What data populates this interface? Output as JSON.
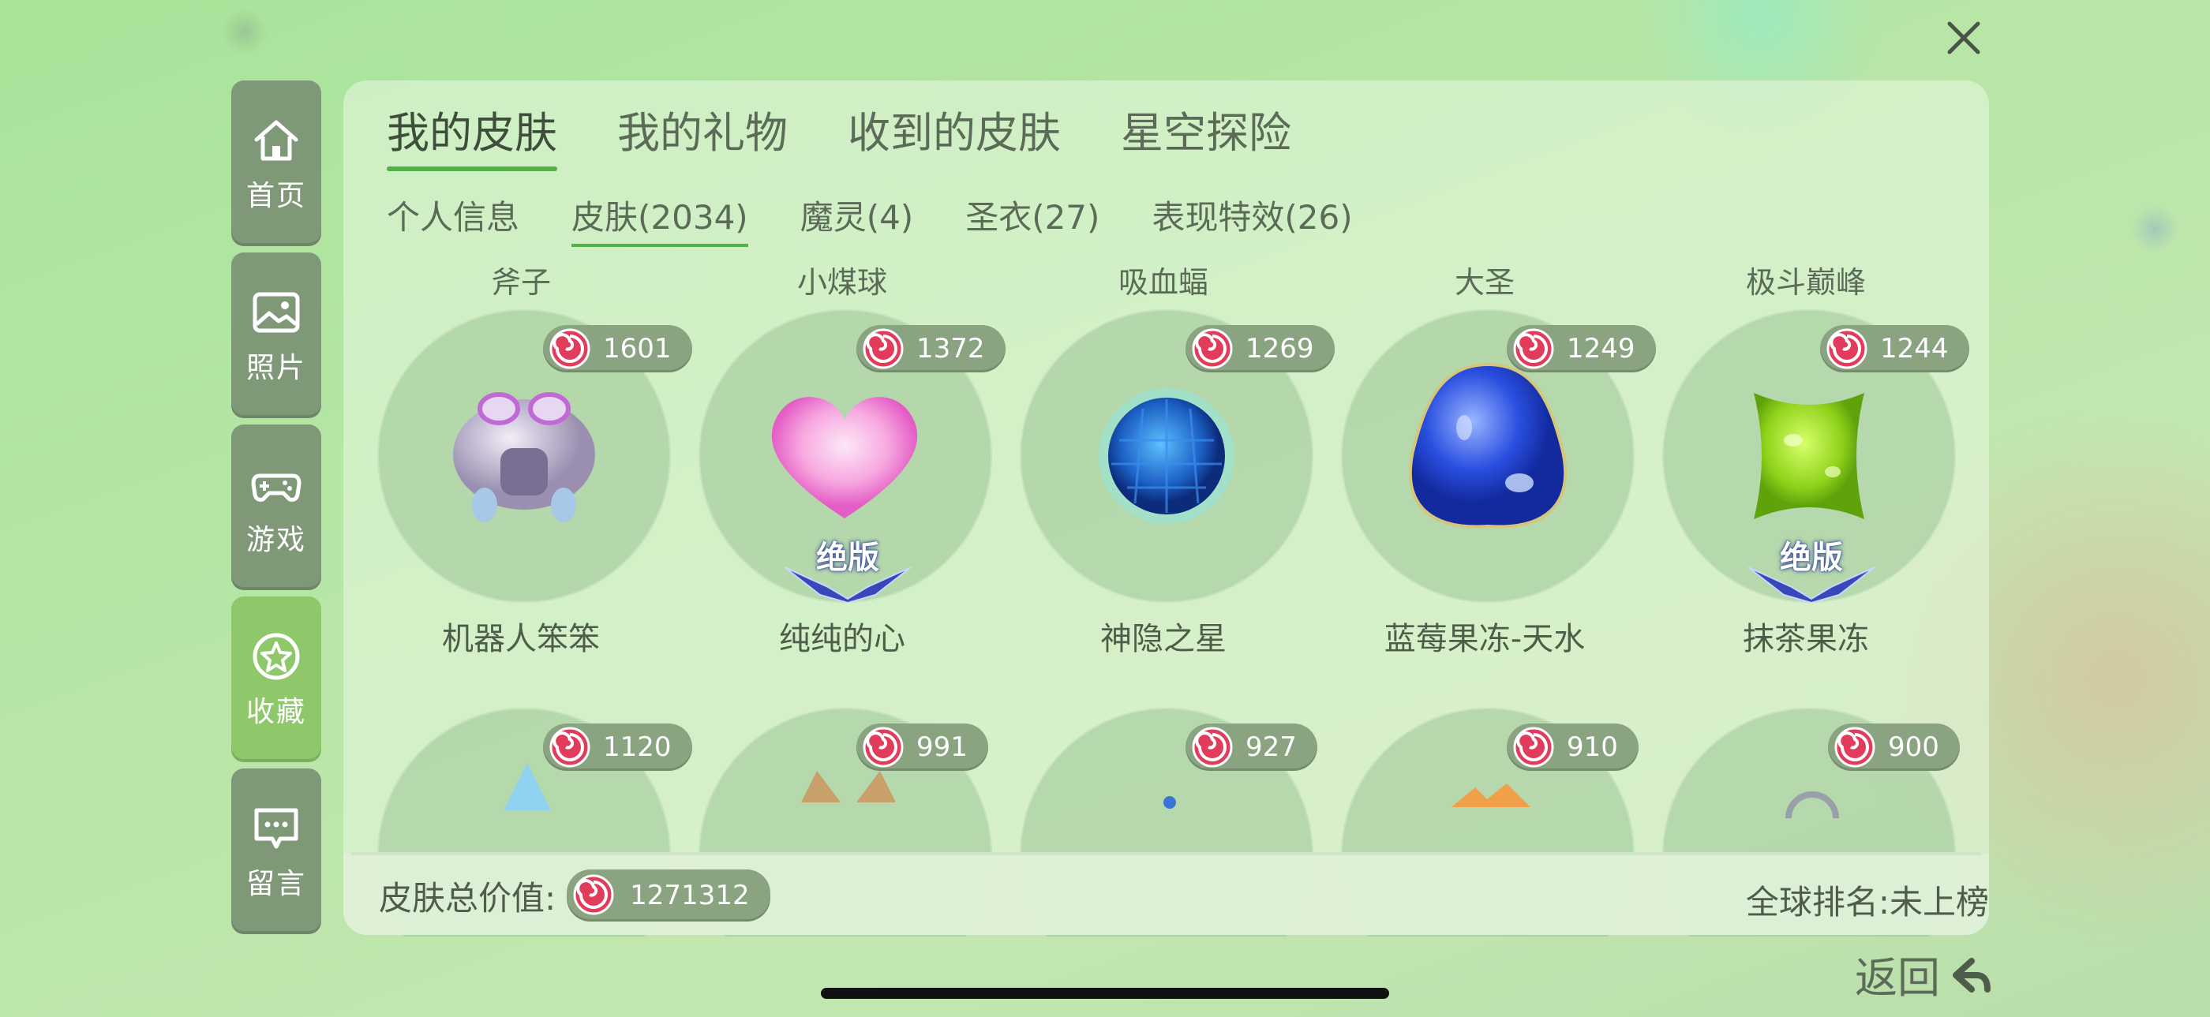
{
  "top_tabs": [
    {
      "label": "我的皮肤",
      "active": true
    },
    {
      "label": "我的礼物",
      "active": false
    },
    {
      "label": "收到的皮肤",
      "active": false
    },
    {
      "label": "星空探险",
      "active": false
    }
  ],
  "sub_tabs": [
    {
      "label": "个人信息",
      "active": false
    },
    {
      "label": "皮肤(2034)",
      "active": true
    },
    {
      "label": "魔灵(4)",
      "active": false
    },
    {
      "label": "圣衣(27)",
      "active": false
    },
    {
      "label": "表现特效(26)",
      "active": false
    }
  ],
  "sidebar": [
    {
      "label": "首页",
      "icon": "home-icon",
      "active": false
    },
    {
      "label": "照片",
      "icon": "photo-icon",
      "active": false
    },
    {
      "label": "游戏",
      "icon": "gamepad-icon",
      "active": false
    },
    {
      "label": "收藏",
      "icon": "star-icon",
      "active": true
    },
    {
      "label": "留言",
      "icon": "message-icon",
      "active": false
    }
  ],
  "columns": [
    {
      "category": "斧子",
      "items": [
        {
          "price": "1601",
          "name": "机器人笨笨",
          "badge": "",
          "art": "robot"
        },
        {
          "price": "1120",
          "art": "crystal"
        }
      ]
    },
    {
      "category": "小煤球",
      "items": [
        {
          "price": "1372",
          "name": "纯纯的心",
          "badge": "绝版",
          "art": "heart"
        },
        {
          "price": "991",
          "art": "ears"
        }
      ]
    },
    {
      "category": "吸血蝠",
      "items": [
        {
          "price": "1269",
          "name": "神隐之星",
          "badge": "",
          "art": "orb"
        },
        {
          "price": "927",
          "art": "dot"
        }
      ]
    },
    {
      "category": "大圣",
      "items": [
        {
          "price": "1249",
          "name": "蓝莓果冻-天水",
          "badge": "",
          "art": "blueberry"
        },
        {
          "price": "910",
          "art": "flame"
        }
      ]
    },
    {
      "category": "极斗巅峰",
      "items": [
        {
          "price": "1244",
          "name": "抹茶果冻",
          "badge": "绝版",
          "art": "matcha"
        },
        {
          "price": "900",
          "art": "ring"
        }
      ]
    }
  ],
  "footer": {
    "total_label": "皮肤总价值:",
    "total_value": "1271312",
    "rank": "全球排名:未上榜"
  },
  "back_label": "返回",
  "colors": {
    "accent": "#52b046",
    "sidebar": "#7e9878",
    "sidebar_active": "#8ec86a",
    "price_pill": "#8aa482"
  }
}
